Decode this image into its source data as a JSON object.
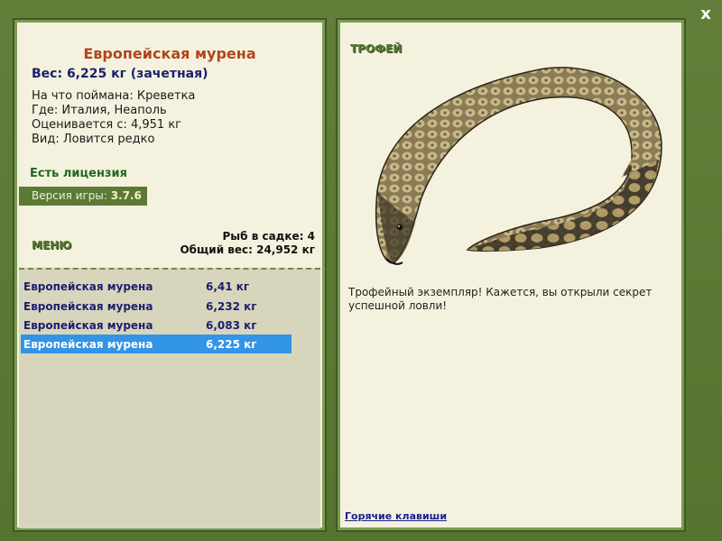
{
  "window": {
    "close_label": "x"
  },
  "left": {
    "title": "Европейская мурена",
    "weight": "Вес: 6,225 кг (зачетная)",
    "info": [
      "На что поймана: Креветка",
      "Где: Италия, Неаполь",
      "Оценивается с: 4,951 кг",
      "Вид: Ловится редко"
    ],
    "license": "Есть лицензия",
    "version_label": "Версия игры:",
    "version_value": "3.7.6",
    "menu_label": "МЕНЮ",
    "cage_count": "Рыб в садке: 4",
    "cage_total": "Общий вес: 24,952 кг",
    "catch_list": [
      {
        "name": "Европейская мурена",
        "weight": "6,41 кг"
      },
      {
        "name": "Европейская мурена",
        "weight": "6,232 кг"
      },
      {
        "name": "Европейская мурена",
        "weight": "6,083 кг"
      },
      {
        "name": "Европейская мурена",
        "weight": "6,225 кг",
        "selected": true
      }
    ]
  },
  "right": {
    "trophy_label": "ТРОФЕЙ",
    "description": "Трофейный экземпляр! Кажется, вы открыли секрет успешной ловли!",
    "hotkeys_label": "Горячие клавиши"
  },
  "colors": {
    "frame": "#5a7a34",
    "panel_bg": "#f4f2de",
    "title": "#b3441b",
    "selected": "#3294e6"
  },
  "icons": {
    "close": "close-icon",
    "fish": "moray-eel-image"
  }
}
